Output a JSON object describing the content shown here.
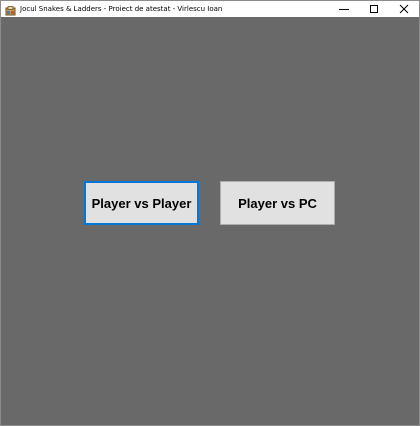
{
  "window": {
    "title": "Jocul Snakes & Ladders - Proiect de atestat - Virlescu Ioan",
    "icon": "app-icon",
    "controls": [
      "minimize-icon",
      "maximize-icon",
      "close-icon"
    ]
  },
  "menu": {
    "player_vs_player": "Player vs Player",
    "player_vs_pc": "Player vs PC"
  },
  "colors": {
    "background": "#696969",
    "button_face": "#e1e1e1",
    "focus_border": "#0078d7"
  }
}
